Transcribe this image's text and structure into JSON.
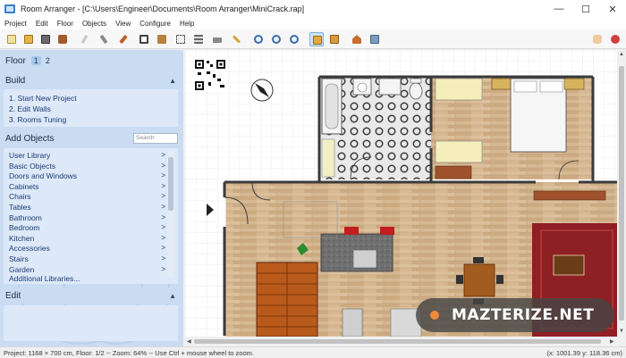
{
  "window": {
    "title": "Room Arranger - [C:\\Users\\Engineer\\Documents\\Room Arranger\\MiniCrack.rap]",
    "minimize_glyph": "—",
    "maximize_glyph": "☐",
    "close_glyph": "✕"
  },
  "menu": [
    "Project",
    "Edit",
    "Floor",
    "Objects",
    "View",
    "Configure",
    "Help"
  ],
  "toolbar": {
    "icons": [
      "new-project-icon",
      "open-folder-icon",
      "save-icon",
      "print-icon",
      "wand-icon",
      "broom-icon",
      "paint-icon",
      "wall-icon",
      "floor-icon",
      "select-icon",
      "stairs-icon",
      "bed-icon",
      "pencil-icon",
      "zoom-fit-icon",
      "zoom-in-icon",
      "zoom-out-icon",
      "2d-view-icon",
      "3d-view-icon",
      "house-icon",
      "objects-3d-icon",
      "hand-icon",
      "help-icon"
    ]
  },
  "sidebar": {
    "floor": {
      "title": "Floor",
      "tabs": [
        "1",
        "2"
      ],
      "active": "1"
    },
    "build": {
      "title": "Build",
      "steps": [
        "1. Start New Project",
        "2. Edit Walls",
        "3. Rooms Tuning"
      ]
    },
    "add_objects": {
      "title": "Add Objects",
      "search_placeholder": "Search",
      "libraries": [
        "User Library",
        "Basic Objects",
        "Doors and Windows",
        "Cabinets",
        "Chairs",
        "Tables",
        "Bathroom",
        "Bedroom",
        "Kitchen",
        "Accessories",
        "Stairs",
        "Garden"
      ],
      "arrow": ">",
      "additional": "Additional Libraries..."
    },
    "edit": {
      "title": "Edit"
    }
  },
  "status": {
    "left": "Project: 1168 × 700 cm, Floor: 1/2 -- Zoom: 64% -- Use Ctrl + mouse wheel to zoom.",
    "right": "(x: 1001.39 y: 118.36 cm)"
  },
  "watermark": "MAZTERIZE.NET",
  "colors": {
    "sidebar_bg": "#c9dcf2",
    "panel_bg": "#dde9f8",
    "wood_floor": "#d4b690",
    "carpet": "#8e1f24",
    "watermark_dot": "#f08a3c"
  }
}
